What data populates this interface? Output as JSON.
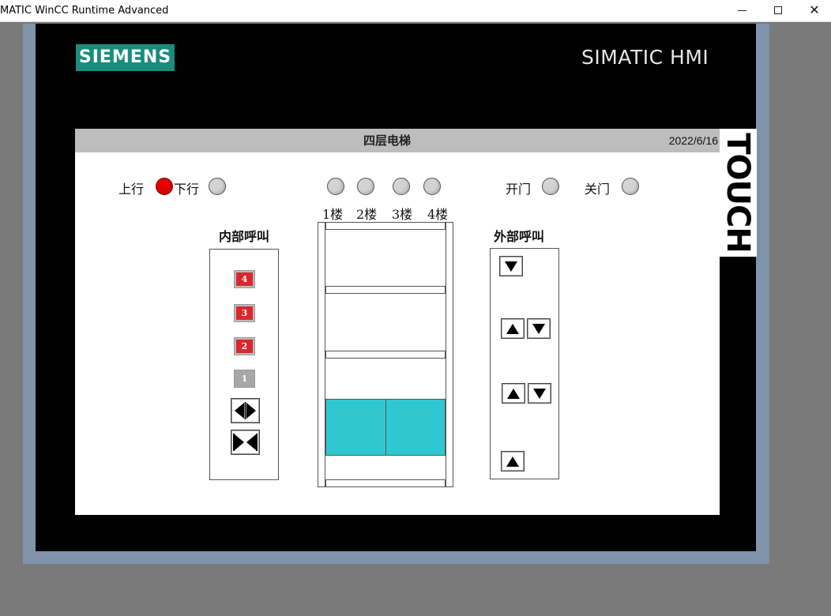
{
  "window": {
    "title": "MATIC WinCC Runtime Advanced",
    "controls": {
      "minimize": "",
      "maximize": "",
      "close": "✕"
    }
  },
  "panel": {
    "brand": "SIEMENS",
    "model": "SIMATIC HMI",
    "side_label": "TOUCH"
  },
  "screen": {
    "title": "四层电梯",
    "date": "2022/6/16",
    "direction": {
      "up_label": "上行",
      "down_label": "下行",
      "up_on": true,
      "down_on": false
    },
    "floor_indicators": [
      {
        "label": "1楼",
        "on": false
      },
      {
        "label": "2楼",
        "on": false
      },
      {
        "label": "3楼",
        "on": false
      },
      {
        "label": "4楼",
        "on": false
      }
    ],
    "door_status": {
      "open_label": "开门",
      "close_label": "关门",
      "open_on": false,
      "close_on": false
    },
    "internal_call": {
      "title": "内部呼叫",
      "buttons": [
        {
          "label": "4",
          "lit": true
        },
        {
          "label": "3",
          "lit": true
        },
        {
          "label": "2",
          "lit": true
        },
        {
          "label": "1",
          "lit": false
        }
      ],
      "open_door_icon": "door-open-icon",
      "close_door_icon": "door-close-icon"
    },
    "external_call": {
      "title": "外部呼叫"
    },
    "car_color": "#30c8d0"
  }
}
